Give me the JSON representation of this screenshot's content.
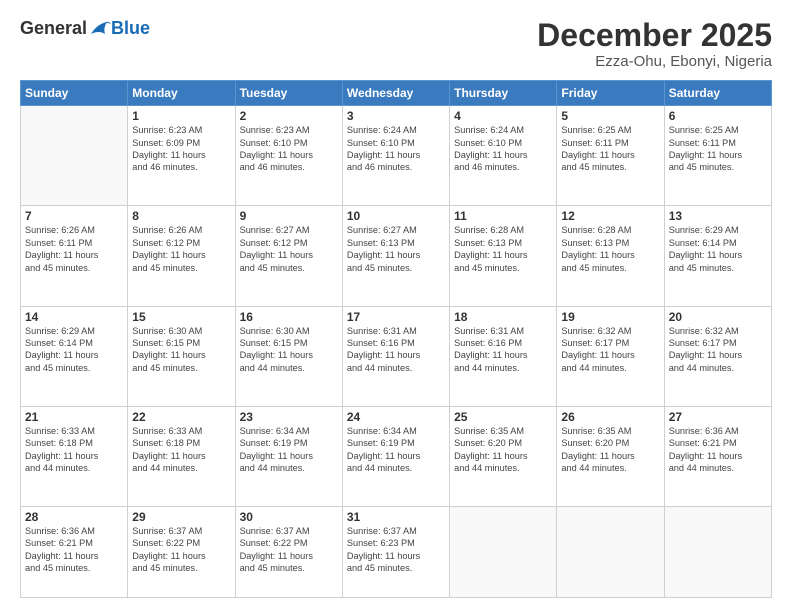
{
  "header": {
    "logo_general": "General",
    "logo_blue": "Blue",
    "month_title": "December 2025",
    "location": "Ezza-Ohu, Ebonyi, Nigeria"
  },
  "days_of_week": [
    "Sunday",
    "Monday",
    "Tuesday",
    "Wednesday",
    "Thursday",
    "Friday",
    "Saturday"
  ],
  "weeks": [
    [
      {
        "day": "",
        "info": ""
      },
      {
        "day": "1",
        "info": "Sunrise: 6:23 AM\nSunset: 6:09 PM\nDaylight: 11 hours\nand 46 minutes."
      },
      {
        "day": "2",
        "info": "Sunrise: 6:23 AM\nSunset: 6:10 PM\nDaylight: 11 hours\nand 46 minutes."
      },
      {
        "day": "3",
        "info": "Sunrise: 6:24 AM\nSunset: 6:10 PM\nDaylight: 11 hours\nand 46 minutes."
      },
      {
        "day": "4",
        "info": "Sunrise: 6:24 AM\nSunset: 6:10 PM\nDaylight: 11 hours\nand 46 minutes."
      },
      {
        "day": "5",
        "info": "Sunrise: 6:25 AM\nSunset: 6:11 PM\nDaylight: 11 hours\nand 45 minutes."
      },
      {
        "day": "6",
        "info": "Sunrise: 6:25 AM\nSunset: 6:11 PM\nDaylight: 11 hours\nand 45 minutes."
      }
    ],
    [
      {
        "day": "7",
        "info": "Sunrise: 6:26 AM\nSunset: 6:11 PM\nDaylight: 11 hours\nand 45 minutes."
      },
      {
        "day": "8",
        "info": "Sunrise: 6:26 AM\nSunset: 6:12 PM\nDaylight: 11 hours\nand 45 minutes."
      },
      {
        "day": "9",
        "info": "Sunrise: 6:27 AM\nSunset: 6:12 PM\nDaylight: 11 hours\nand 45 minutes."
      },
      {
        "day": "10",
        "info": "Sunrise: 6:27 AM\nSunset: 6:13 PM\nDaylight: 11 hours\nand 45 minutes."
      },
      {
        "day": "11",
        "info": "Sunrise: 6:28 AM\nSunset: 6:13 PM\nDaylight: 11 hours\nand 45 minutes."
      },
      {
        "day": "12",
        "info": "Sunrise: 6:28 AM\nSunset: 6:13 PM\nDaylight: 11 hours\nand 45 minutes."
      },
      {
        "day": "13",
        "info": "Sunrise: 6:29 AM\nSunset: 6:14 PM\nDaylight: 11 hours\nand 45 minutes."
      }
    ],
    [
      {
        "day": "14",
        "info": "Sunrise: 6:29 AM\nSunset: 6:14 PM\nDaylight: 11 hours\nand 45 minutes."
      },
      {
        "day": "15",
        "info": "Sunrise: 6:30 AM\nSunset: 6:15 PM\nDaylight: 11 hours\nand 45 minutes."
      },
      {
        "day": "16",
        "info": "Sunrise: 6:30 AM\nSunset: 6:15 PM\nDaylight: 11 hours\nand 44 minutes."
      },
      {
        "day": "17",
        "info": "Sunrise: 6:31 AM\nSunset: 6:16 PM\nDaylight: 11 hours\nand 44 minutes."
      },
      {
        "day": "18",
        "info": "Sunrise: 6:31 AM\nSunset: 6:16 PM\nDaylight: 11 hours\nand 44 minutes."
      },
      {
        "day": "19",
        "info": "Sunrise: 6:32 AM\nSunset: 6:17 PM\nDaylight: 11 hours\nand 44 minutes."
      },
      {
        "day": "20",
        "info": "Sunrise: 6:32 AM\nSunset: 6:17 PM\nDaylight: 11 hours\nand 44 minutes."
      }
    ],
    [
      {
        "day": "21",
        "info": "Sunrise: 6:33 AM\nSunset: 6:18 PM\nDaylight: 11 hours\nand 44 minutes."
      },
      {
        "day": "22",
        "info": "Sunrise: 6:33 AM\nSunset: 6:18 PM\nDaylight: 11 hours\nand 44 minutes."
      },
      {
        "day": "23",
        "info": "Sunrise: 6:34 AM\nSunset: 6:19 PM\nDaylight: 11 hours\nand 44 minutes."
      },
      {
        "day": "24",
        "info": "Sunrise: 6:34 AM\nSunset: 6:19 PM\nDaylight: 11 hours\nand 44 minutes."
      },
      {
        "day": "25",
        "info": "Sunrise: 6:35 AM\nSunset: 6:20 PM\nDaylight: 11 hours\nand 44 minutes."
      },
      {
        "day": "26",
        "info": "Sunrise: 6:35 AM\nSunset: 6:20 PM\nDaylight: 11 hours\nand 44 minutes."
      },
      {
        "day": "27",
        "info": "Sunrise: 6:36 AM\nSunset: 6:21 PM\nDaylight: 11 hours\nand 44 minutes."
      }
    ],
    [
      {
        "day": "28",
        "info": "Sunrise: 6:36 AM\nSunset: 6:21 PM\nDaylight: 11 hours\nand 45 minutes."
      },
      {
        "day": "29",
        "info": "Sunrise: 6:37 AM\nSunset: 6:22 PM\nDaylight: 11 hours\nand 45 minutes."
      },
      {
        "day": "30",
        "info": "Sunrise: 6:37 AM\nSunset: 6:22 PM\nDaylight: 11 hours\nand 45 minutes."
      },
      {
        "day": "31",
        "info": "Sunrise: 6:37 AM\nSunset: 6:23 PM\nDaylight: 11 hours\nand 45 minutes."
      },
      {
        "day": "",
        "info": ""
      },
      {
        "day": "",
        "info": ""
      },
      {
        "day": "",
        "info": ""
      }
    ]
  ]
}
